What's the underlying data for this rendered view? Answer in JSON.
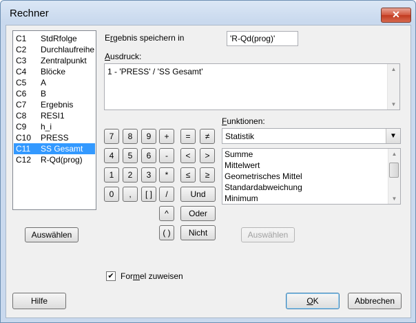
{
  "window": {
    "title": "Rechner",
    "close_glyph": "✕"
  },
  "columns": [
    {
      "id": "C1",
      "name": "StdRfolge",
      "selected": false
    },
    {
      "id": "C2",
      "name": "Durchlaufreihe",
      "selected": false
    },
    {
      "id": "C3",
      "name": "Zentralpunkt",
      "selected": false
    },
    {
      "id": "C4",
      "name": "Blöcke",
      "selected": false
    },
    {
      "id": "C5",
      "name": "A",
      "selected": false
    },
    {
      "id": "C6",
      "name": "B",
      "selected": false
    },
    {
      "id": "C7",
      "name": "Ergebnis",
      "selected": false
    },
    {
      "id": "C8",
      "name": "RESI1",
      "selected": false
    },
    {
      "id": "C9",
      "name": "h_i",
      "selected": false
    },
    {
      "id": "C10",
      "name": "PRESS",
      "selected": false
    },
    {
      "id": "C11",
      "name": "SS Gesamt",
      "selected": true
    },
    {
      "id": "C12",
      "name": "R-Qd(prog)",
      "selected": false
    }
  ],
  "store": {
    "label_pre": "E",
    "label_ul": "r",
    "label_post": "gebnis speichern in",
    "value": "'R-Qd(prog)'"
  },
  "expression": {
    "label_ul": "A",
    "label_post": "usdruck:",
    "value": "1 - 'PRESS' / 'SS Gesamt'"
  },
  "keypad": {
    "row1": [
      "7",
      "8",
      "9",
      "+",
      "=",
      "≠"
    ],
    "row2": [
      "4",
      "5",
      "6",
      "-",
      "<",
      ">"
    ],
    "row3": [
      "1",
      "2",
      "3",
      "*",
      "≤",
      "≥"
    ],
    "row4": [
      "0",
      ",",
      "[ ]",
      "/"
    ],
    "power": "^",
    "parens": "( )",
    "and": "Und",
    "or": "Oder",
    "not": "Nicht"
  },
  "functions": {
    "label_ul": "F",
    "label_post": "unktionen:",
    "category": "Statistik",
    "items": [
      "Summe",
      "Mittelwert",
      "Geometrisches Mittel",
      "Standardabweichung",
      "Minimum"
    ],
    "select_label": "Auswählen"
  },
  "column_select_label": "Auswählen",
  "formula": {
    "checked": true,
    "check_glyph": "✔",
    "label_pre": "For",
    "label_ul": "m",
    "label_post": "el zuweisen"
  },
  "buttons": {
    "help": "Hilfe",
    "ok_ul": "O",
    "ok_post": "K",
    "cancel": "Abbrechen"
  }
}
